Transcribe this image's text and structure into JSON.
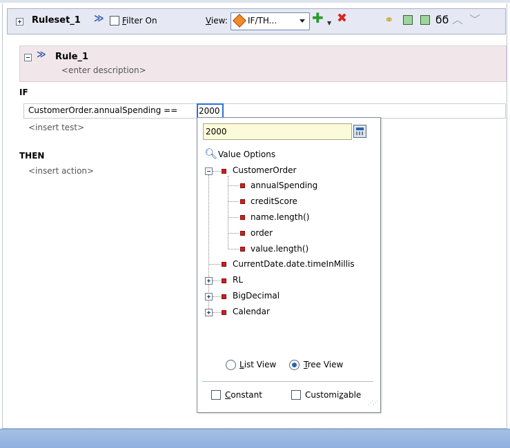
{
  "toolbar": {
    "ruleset_name": "Ruleset_1",
    "filter_label_prefix": "",
    "filter_mnemonic": "F",
    "filter_label_rest": "ilter On",
    "view_mnemonic": "V",
    "view_label_rest": "iew:",
    "view_value": "IF/TH...",
    "add_icon": "add-icon",
    "delete_icon": "delete-icon"
  },
  "rule": {
    "name": "Rule_1",
    "description_placeholder": "<enter description>"
  },
  "if_label": "IF",
  "test_expression": "CustomerOrder.annualSpending ==",
  "test_value": "2000",
  "insert_test": "<insert test>",
  "then_label": "THEN",
  "insert_action": "<insert action>",
  "popup": {
    "input_value": "2000",
    "value_options_label": "Value Options",
    "tree": {
      "root": "CustomerOrder",
      "children": [
        "annualSpending",
        "creditScore",
        "name.length()",
        "order",
        "value.length()"
      ],
      "siblings": [
        "CurrentDate.date.timeInMillis",
        "RL",
        "BigDecimal",
        "Calendar"
      ]
    },
    "list_view_mnemonic": "L",
    "list_view_rest": "ist View",
    "tree_view_mnemonic": "T",
    "tree_view_rest": "ree View",
    "selected_view": "Tree View",
    "constant_mnemonic": "C",
    "constant_rest": "onstant",
    "customizable_pre": "Customi",
    "customizable_mnemonic": "z",
    "customizable_rest": "able"
  }
}
